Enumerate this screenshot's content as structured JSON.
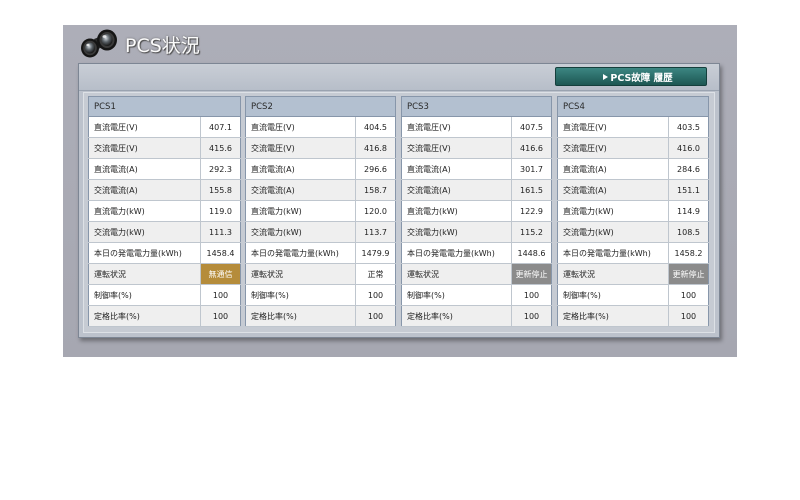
{
  "page": {
    "title": "PCS状況",
    "title_icon": "binoculars-icon"
  },
  "toolbar": {
    "history_button": {
      "icon": "triangle-right-icon",
      "label": "PCS故障 履歴",
      "color": "#27635f"
    }
  },
  "pcs_units": [
    {
      "name": "PCS1",
      "status_bg": "#b58c3b",
      "status_fg": "#ffffff",
      "rows": [
        {
          "label": "直流電圧(V)",
          "value": "407.1"
        },
        {
          "label": "交流電圧(V)",
          "value": "415.6"
        },
        {
          "label": "直流電流(A)",
          "value": "292.3"
        },
        {
          "label": "交流電流(A)",
          "value": "155.8"
        },
        {
          "label": "直流電力(kW)",
          "value": "119.0"
        },
        {
          "label": "交流電力(kW)",
          "value": "111.3"
        },
        {
          "label": "本日の発電電力量(kWh)",
          "value": "1458.4"
        },
        {
          "label": "運転状況",
          "value": "無通信"
        },
        {
          "label": "制御率(%)",
          "value": "100"
        },
        {
          "label": "定格比率(%)",
          "value": "100"
        }
      ]
    },
    {
      "name": "PCS2",
      "status_bg": "#ffffff",
      "status_fg": "#222222",
      "rows": [
        {
          "label": "直流電圧(V)",
          "value": "404.5"
        },
        {
          "label": "交流電圧(V)",
          "value": "416.8"
        },
        {
          "label": "直流電流(A)",
          "value": "296.6"
        },
        {
          "label": "交流電流(A)",
          "value": "158.7"
        },
        {
          "label": "直流電力(kW)",
          "value": "120.0"
        },
        {
          "label": "交流電力(kW)",
          "value": "113.7"
        },
        {
          "label": "本日の発電電力量(kWh)",
          "value": "1479.9"
        },
        {
          "label": "運転状況",
          "value": "正常"
        },
        {
          "label": "制御率(%)",
          "value": "100"
        },
        {
          "label": "定格比率(%)",
          "value": "100"
        }
      ]
    },
    {
      "name": "PCS3",
      "status_bg": "#8b8b8b",
      "status_fg": "#ffffff",
      "rows": [
        {
          "label": "直流電圧(V)",
          "value": "407.5"
        },
        {
          "label": "交流電圧(V)",
          "value": "416.6"
        },
        {
          "label": "直流電流(A)",
          "value": "301.7"
        },
        {
          "label": "交流電流(A)",
          "value": "161.5"
        },
        {
          "label": "直流電力(kW)",
          "value": "122.9"
        },
        {
          "label": "交流電力(kW)",
          "value": "115.2"
        },
        {
          "label": "本日の発電電力量(kWh)",
          "value": "1448.6"
        },
        {
          "label": "運転状況",
          "value": "更新停止"
        },
        {
          "label": "制御率(%)",
          "value": "100"
        },
        {
          "label": "定格比率(%)",
          "value": "100"
        }
      ]
    },
    {
      "name": "PCS4",
      "status_bg": "#8b8b8b",
      "status_fg": "#ffffff",
      "rows": [
        {
          "label": "直流電圧(V)",
          "value": "403.5"
        },
        {
          "label": "交流電圧(V)",
          "value": "416.0"
        },
        {
          "label": "直流電流(A)",
          "value": "284.6"
        },
        {
          "label": "交流電流(A)",
          "value": "151.1"
        },
        {
          "label": "直流電力(kW)",
          "value": "114.9"
        },
        {
          "label": "交流電力(kW)",
          "value": "108.5"
        },
        {
          "label": "本日の発電電力量(kWh)",
          "value": "1458.2"
        },
        {
          "label": "運転状況",
          "value": "更新停止"
        },
        {
          "label": "制御率(%)",
          "value": "100"
        },
        {
          "label": "定格比率(%)",
          "value": "100"
        }
      ]
    }
  ]
}
